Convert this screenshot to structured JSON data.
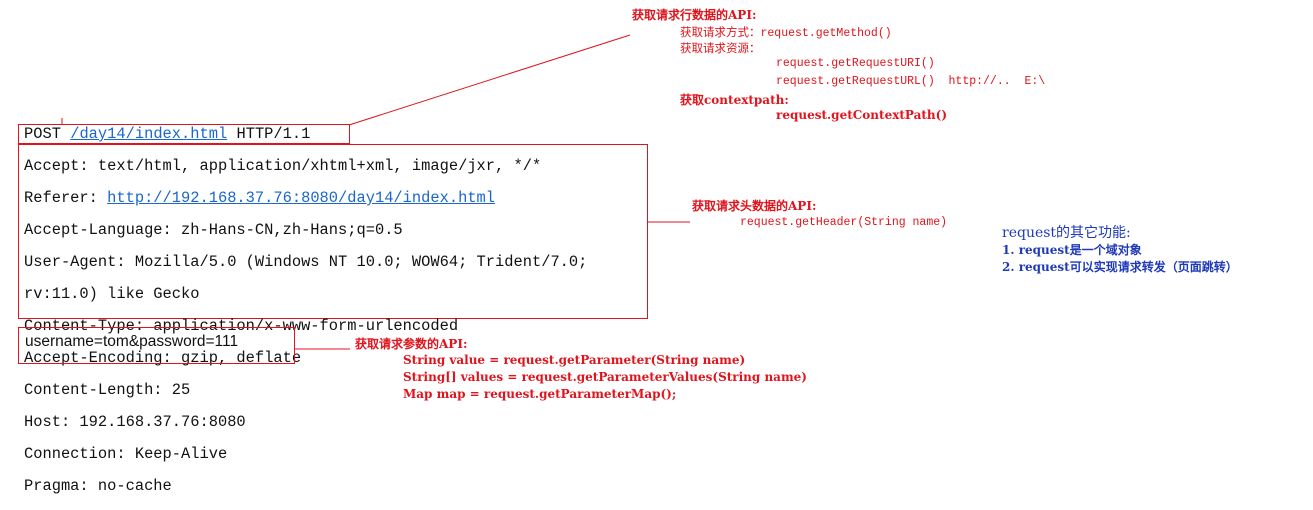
{
  "request_line": {
    "method": "POST",
    "path": "/day14/index.html",
    "protocol": "HTTP/1.1"
  },
  "headers": [
    "Accept: text/html, application/xhtml+xml, image/jxr, */*",
    "Referer: ",
    "Accept-Language: zh-Hans-CN,zh-Hans;q=0.5",
    "User-Agent: Mozilla/5.0 (Windows NT 10.0; WOW64; Trident/7.0;",
    "rv:11.0) like Gecko",
    "Content-Type: application/x-www-form-urlencoded",
    "Accept-Encoding: gzip, deflate",
    "Content-Length: 25",
    "Host: 192.168.37.76:8080",
    "Connection: Keep-Alive",
    "Pragma: no-cache"
  ],
  "referer_url": "http://192.168.37.76:8080/day14/index.html",
  "body": "username=tom&password=111",
  "line_api": {
    "title": "获取请求行数据的API:",
    "method_label": "获取请求方式：request.getMethod()",
    "resource_label": "获取请求资源：",
    "uri": "request.getRequestURI()",
    "url": "request.getRequestURL()  http://..  E:\\",
    "contextpath_label": "获取contextpath:",
    "contextpath_api": "request.getContextPath()"
  },
  "header_api": {
    "title": "获取请求头数据的API:",
    "call": "request.getHeader(String name)"
  },
  "param_api": {
    "title": "获取请求参数的API:",
    "line1": "String value = request.getParameter(String name)",
    "line2": "String[] values = request.getParameterValues(String name)",
    "line3": "Map map = request.getParameterMap();"
  },
  "other": {
    "title": "request的其它功能:",
    "item1": "1. request是一个域对象",
    "item2": "2. request可以实现请求转发（页面跳转）"
  },
  "colors": {
    "annotation_red": "#e0141c",
    "link_blue": "#1a66cc",
    "note_blue": "#1f3ab8"
  }
}
